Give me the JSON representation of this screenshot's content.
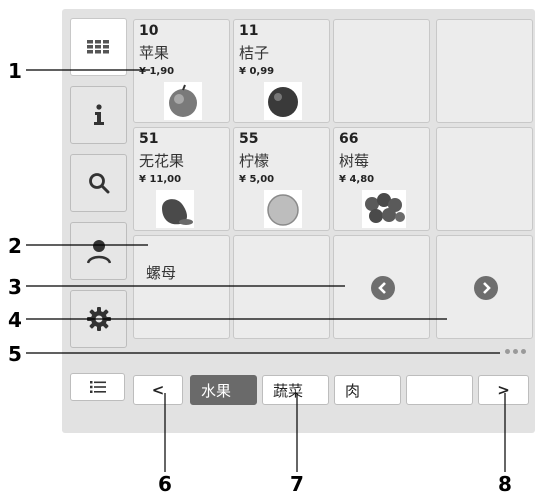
{
  "callouts": {
    "c1": "1",
    "c2": "2",
    "c3": "3",
    "c4": "4",
    "c5": "5",
    "c6": "6",
    "c7": "7",
    "c8": "8"
  },
  "sidebar": {
    "items": [
      {
        "name": "grid-view",
        "icon": "grid-icon",
        "active": true
      },
      {
        "name": "info",
        "icon": "info-icon"
      },
      {
        "name": "search",
        "icon": "search-icon"
      },
      {
        "name": "user",
        "icon": "user-icon"
      },
      {
        "name": "settings",
        "icon": "gear-icon"
      }
    ],
    "list_icon": "list-icon"
  },
  "tiles": [
    {
      "plu": "10",
      "name": "苹果",
      "price": "¥ 1,90",
      "image": "apple"
    },
    {
      "plu": "11",
      "name": "桔子",
      "price": "¥ 0,99",
      "image": "orange"
    },
    {
      "plu": "",
      "name": "",
      "price": ""
    },
    {
      "plu": "",
      "name": "",
      "price": ""
    },
    {
      "plu": "51",
      "name": "无花果",
      "price": "¥ 11,00",
      "image": "fig"
    },
    {
      "plu": "55",
      "name": "柠檬",
      "price": "¥ 5,00",
      "image": "lemon"
    },
    {
      "plu": "66",
      "name": "树莓",
      "price": "¥ 4,80",
      "image": "raspberry"
    },
    {
      "plu": "",
      "name": "",
      "price": ""
    },
    {
      "plu": "",
      "name": "螺母",
      "price": ""
    },
    {
      "plu": "",
      "name": "",
      "price": ""
    },
    {
      "plu": "",
      "name": "",
      "price": "",
      "nav": "chevron-left-icon"
    },
    {
      "plu": "",
      "name": "",
      "price": "",
      "nav": "chevron-right-icon"
    }
  ],
  "tabs": {
    "prev_label": "<",
    "next_label": ">",
    "items": [
      {
        "label": "水果",
        "selected": true
      },
      {
        "label": "蔬菜"
      },
      {
        "label": "肉"
      },
      {
        "label": ""
      }
    ]
  },
  "colors": {
    "panel": "#e2e2e2",
    "tile": "#ececec",
    "selected_tab": "#6a6a6a",
    "nav_circle": "#6e6e6e"
  }
}
